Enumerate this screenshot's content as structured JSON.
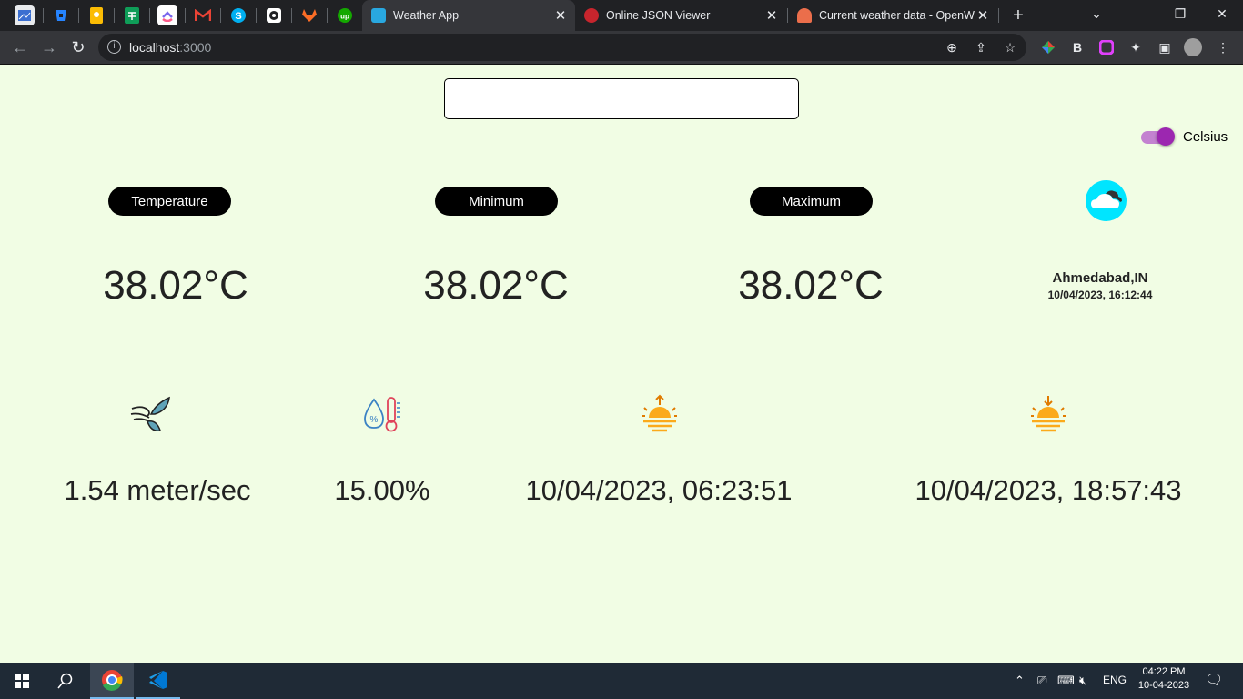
{
  "browser": {
    "pinned_tabs": [
      {
        "icon": "screenshot-icon",
        "color": "#6ea8ff"
      },
      {
        "icon": "bitbucket-icon",
        "color": "#2684ff"
      },
      {
        "icon": "keep-icon",
        "color": "#fbbc04"
      },
      {
        "icon": "sheets-icon",
        "color": "#0f9d58"
      },
      {
        "icon": "clickup-icon",
        "color": "#7b68ee"
      },
      {
        "icon": "gmail-icon",
        "color": "#ea4335"
      },
      {
        "icon": "skype-icon",
        "color": "#00aff0"
      },
      {
        "icon": "camera-icon",
        "color": "#ffffff"
      },
      {
        "icon": "gitlab-icon",
        "color": "#fc6d26"
      },
      {
        "icon": "upwork-icon",
        "color": "#14a800"
      }
    ],
    "tabs": [
      {
        "label": "Weather App",
        "icon": "weather-app-icon",
        "active": true
      },
      {
        "label": "Online JSON Viewer",
        "icon": "opera-icon",
        "active": false
      },
      {
        "label": "Current weather data - OpenWe",
        "icon": "openweather-icon",
        "active": false
      }
    ],
    "new_tab": "+",
    "url_host": "localhost",
    "url_port": ":3000"
  },
  "app": {
    "search": {
      "value": "",
      "placeholder": ""
    },
    "unit_toggle": {
      "label": "Celsius",
      "on": true
    },
    "labels": {
      "temperature": "Temperature",
      "minimum": "Minimum",
      "maximum": "Maximum"
    },
    "values": {
      "temperature": "38.02°C",
      "minimum": "38.02°C",
      "maximum": "38.02°C"
    },
    "location": {
      "city": "Ahmedabad,IN",
      "datetime": "10/04/2023, 16:12:44",
      "weather_icon": "cloud-icon"
    },
    "stats": {
      "wind": "1.54 meter/sec",
      "humidity": "15.00%",
      "sunrise": "10/04/2023, 06:23:51",
      "sunset": "10/04/2023, 18:57:43"
    }
  },
  "taskbar": {
    "lang": "ENG",
    "time": "04:22 PM",
    "date": "10-04-2023"
  }
}
